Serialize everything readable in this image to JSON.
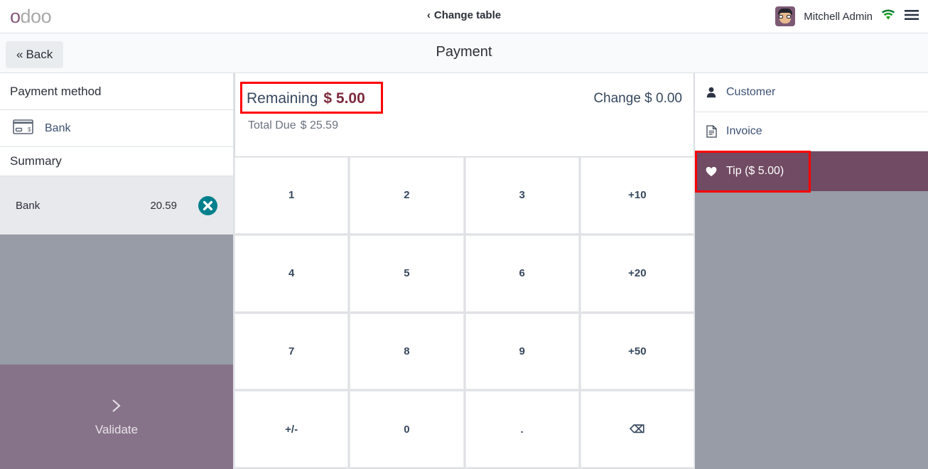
{
  "topbar": {
    "logo_first": "o",
    "logo_rest": "doo",
    "change_table": "Change table",
    "change_table_chevron": "‹",
    "username": "Mitchell Admin",
    "wifi_icon": "wifi-icon",
    "menu_icon": "hamburger-menu-icon",
    "avatar_icon": "user-avatar"
  },
  "subheader": {
    "back_label": "Back",
    "back_chevron": "«",
    "title": "Payment"
  },
  "left_panel": {
    "payment_method_header": "Payment method",
    "methods": [
      {
        "label": "Bank",
        "icon": "credit-card-icon"
      }
    ],
    "summary_header": "Summary",
    "summary_lines": [
      {
        "label": "Bank",
        "amount": "20.59",
        "delete_icon": "close-circle-icon"
      }
    ],
    "validate_label": "Validate",
    "validate_icon": "chevron-right-icon"
  },
  "totals": {
    "remaining_label": "Remaining",
    "remaining_value": "$ 5.00",
    "change_label": "Change",
    "change_value": "$ 0.00",
    "total_due_label": "Total Due",
    "total_due_value": "$ 25.59"
  },
  "numpad": {
    "keys": [
      {
        "label": "1",
        "name": "numpad-1"
      },
      {
        "label": "2",
        "name": "numpad-2"
      },
      {
        "label": "3",
        "name": "numpad-3"
      },
      {
        "label": "+10",
        "name": "numpad-plus10"
      },
      {
        "label": "4",
        "name": "numpad-4"
      },
      {
        "label": "5",
        "name": "numpad-5"
      },
      {
        "label": "6",
        "name": "numpad-6"
      },
      {
        "label": "+20",
        "name": "numpad-plus20"
      },
      {
        "label": "7",
        "name": "numpad-7"
      },
      {
        "label": "8",
        "name": "numpad-8"
      },
      {
        "label": "9",
        "name": "numpad-9"
      },
      {
        "label": "+50",
        "name": "numpad-plus50"
      },
      {
        "label": "+/-",
        "name": "numpad-sign"
      },
      {
        "label": "0",
        "name": "numpad-0"
      },
      {
        "label": ".",
        "name": "numpad-decimal"
      },
      {
        "label": "⌫",
        "name": "numpad-backspace"
      }
    ]
  },
  "right_panel": {
    "items": [
      {
        "label": "Customer",
        "icon": "person-icon",
        "active": false
      },
      {
        "label": "Invoice",
        "icon": "document-icon",
        "active": false
      },
      {
        "label": "Tip ($ 5.00)",
        "icon": "heart-icon",
        "active": true
      }
    ]
  },
  "annotations": {
    "highlight_color": "#fe0000",
    "boxes": [
      "remaining-amount",
      "tip-button"
    ]
  },
  "colors": {
    "brand_purple": "#875a7b",
    "tip_active": "#714b63",
    "panel_gray": "#979ca6",
    "teal_delete": "#00808c",
    "remaining_value": "#7d2b3c"
  }
}
